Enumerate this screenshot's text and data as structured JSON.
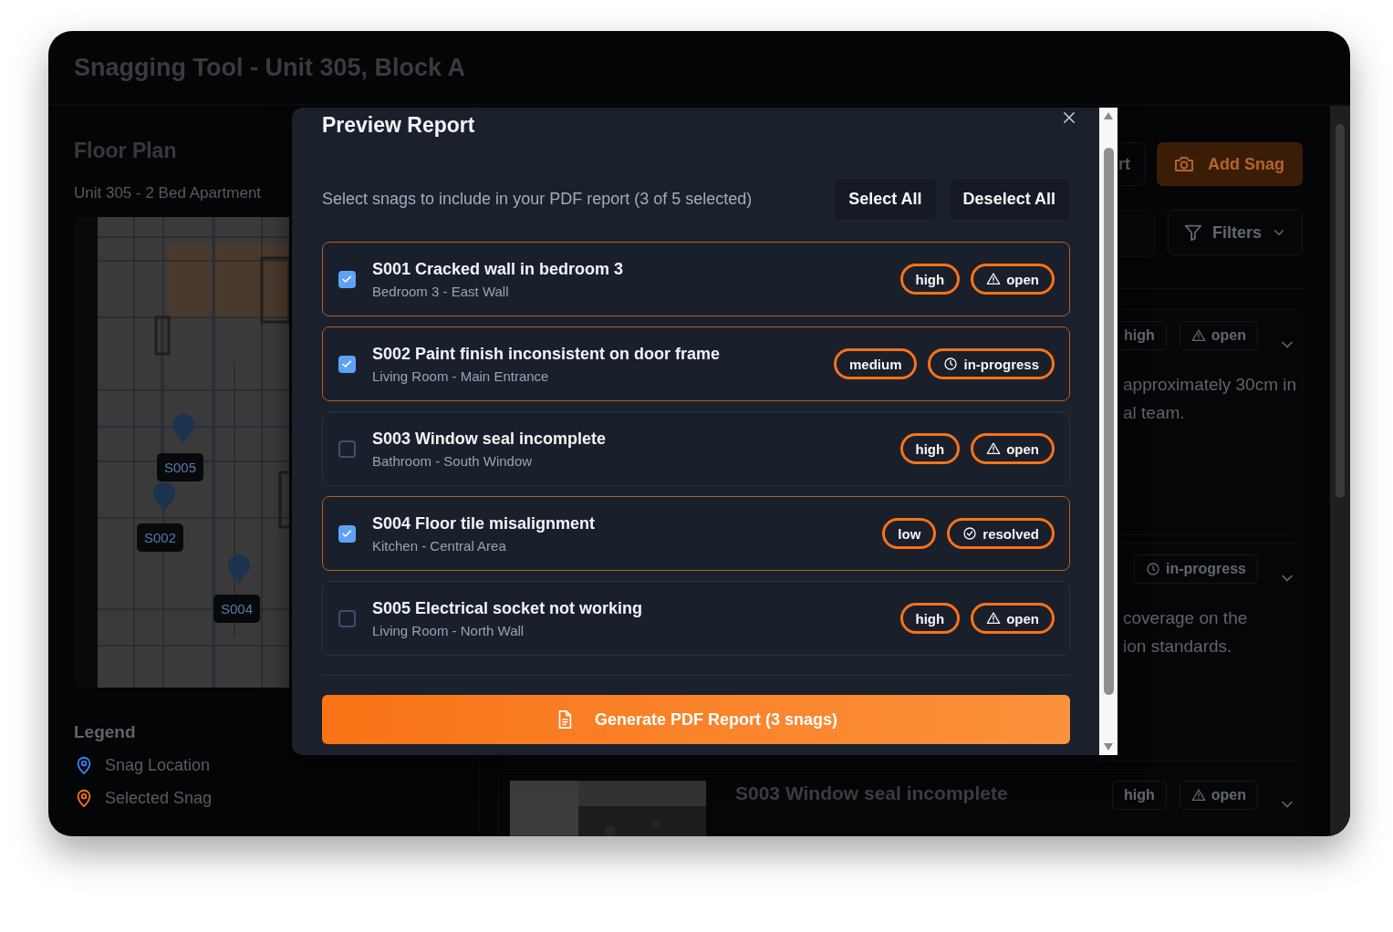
{
  "window": {
    "title": "Snagging Tool - Unit 305, Block A"
  },
  "floor_plan": {
    "title": "Floor Plan",
    "subtitle": "Unit 305 - 2 Bed Apartment",
    "markers": [
      {
        "label": "S005"
      },
      {
        "label": "S002"
      },
      {
        "label": "S004"
      }
    ]
  },
  "legend": {
    "title": "Legend",
    "items": [
      {
        "label": "Snag Location",
        "color": "#3b82f6"
      },
      {
        "label": "Selected Snag",
        "color": "#f97316"
      }
    ]
  },
  "toolbar": {
    "buttons": [
      {
        "label": "rt",
        "kind": "outline"
      },
      {
        "label": "Add Snag",
        "kind": "primary"
      }
    ],
    "filter_button": "Filters"
  },
  "snag_cards": [
    {
      "badges": [
        {
          "label": "high",
          "kind": "priority"
        },
        {
          "label": "open",
          "kind": "alert"
        }
      ],
      "description_lines": [
        "approximately 30cm in",
        "al team."
      ]
    },
    {
      "badges": [
        {
          "label": "in-progress",
          "kind": "pending"
        }
      ],
      "description_lines": [
        "coverage on the",
        "ion standards."
      ]
    },
    {
      "title": "S003 Window seal incomplete",
      "kind": "picture",
      "badges": [
        {
          "label": "high",
          "kind": "priority"
        },
        {
          "label": "open",
          "kind": "alert"
        }
      ]
    }
  ],
  "modal": {
    "title": "Preview Report",
    "instruction": "Select snags to include in your PDF report (3 of 5 selected)",
    "actions": [
      "Select All",
      "Deselect All"
    ],
    "snags": [
      {
        "title": "S001 Cracked wall in bedroom 3",
        "location": "Bedroom 3 - East Wall",
        "checked": true,
        "priority": "high",
        "status": "open",
        "kind": "alert"
      },
      {
        "title": "S002 Paint finish inconsistent on door frame",
        "location": "Living Room - Main Entrance",
        "checked": true,
        "priority": "medium",
        "status": "in-progress",
        "kind": "pending"
      },
      {
        "title": "S003 Window seal incomplete",
        "location": "Bathroom - South Window",
        "checked": false,
        "priority": "high",
        "status": "open",
        "kind": "alert"
      },
      {
        "title": "S004 Floor tile misalignment",
        "location": "Kitchen - Central Area",
        "checked": true,
        "priority": "low",
        "status": "resolved",
        "kind": "done"
      },
      {
        "title": "S005 Electrical socket not working",
        "location": "Living Room - North Wall",
        "checked": false,
        "priority": "high",
        "status": "open",
        "kind": "alert"
      }
    ],
    "generate_button": "Generate PDF Report (3 snags)"
  }
}
